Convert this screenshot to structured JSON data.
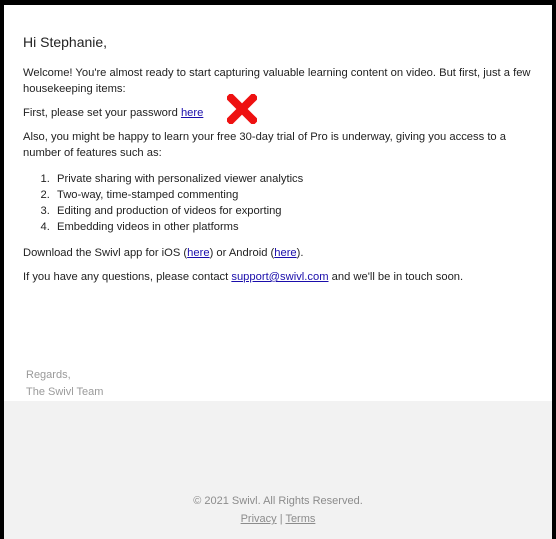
{
  "email": {
    "greeting": "Hi Stephanie,",
    "welcome": "Welcome! You're almost ready to start capturing valuable learning content on video. But first, just a few housekeeping items:",
    "password_prefix": "First, please set your password ",
    "password_link": "here",
    "pro_intro": "Also, you might be happy to learn your free 30-day trial of Pro is underway, giving you access to a number of features such as:",
    "features": [
      "Private sharing with personalized viewer analytics",
      "Two-way, time-stamped commenting",
      "Editing and production of videos for exporting",
      "Embedding videos in other platforms"
    ],
    "download_prefix": "Download the Swivl app for iOS (",
    "ios_link": "here",
    "download_middle": ") or Android (",
    "android_link": "here",
    "download_suffix": ").",
    "questions_prefix": "If you have any questions, please contact ",
    "support_email": "support@swivl.com",
    "questions_suffix": " and we'll be in touch soon.",
    "regards": "Regards,",
    "signature": "The Swivl Team"
  },
  "footer": {
    "copyright": "© 2021 Swivl. All Rights Reserved.",
    "privacy": "Privacy",
    "separator": " | ",
    "terms": "Terms"
  },
  "colors": {
    "link": "#1a0dab",
    "annotation_x": "#ee1111",
    "footer_bg": "#f2f2f2"
  },
  "icons": {
    "annotation": "red-x-mark-icon"
  }
}
